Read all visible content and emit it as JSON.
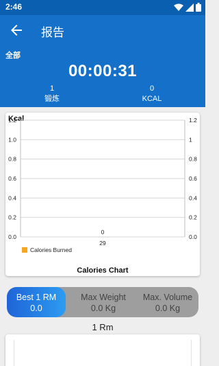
{
  "status_bar": {
    "time": "2:46",
    "icons": [
      "wifi-icon",
      "signal-icon",
      "battery-icon"
    ]
  },
  "app_bar": {
    "title": "报告",
    "back_icon": "arrow-left-icon"
  },
  "summary": {
    "label": "全部",
    "timer": "00:00:31",
    "stats": [
      {
        "value": "1",
        "label": "锻炼"
      },
      {
        "value": "0",
        "label": "KCAL"
      }
    ]
  },
  "chart_data": {
    "type": "bar",
    "ylabel": "Kcal",
    "categories": [
      "29"
    ],
    "series": [
      {
        "name": "Calories Burned",
        "values": [
          0
        ],
        "color": "#f5a623"
      }
    ],
    "data_labels": [
      "0"
    ],
    "ylim_left": [
      0,
      1.2
    ],
    "yticks_left": [
      "0.0",
      "0.2",
      "0.4",
      "0.6",
      "0.8",
      "1.0",
      "1.2"
    ],
    "ylim_right": [
      0,
      1.2
    ],
    "yticks_right": [
      "0.0",
      "0.2",
      "0.4",
      "0.6",
      "0.8",
      "1",
      "1.2"
    ],
    "grid": true,
    "legend_position": "bottom-left",
    "caption": "Calories Chart"
  },
  "segments": [
    {
      "title": "Best 1 RM",
      "value": "0.0",
      "selected": true
    },
    {
      "title": "Max Weight",
      "value": "0.0 Kg",
      "selected": false
    },
    {
      "title": "Max. Volume",
      "value": "0.0 Kg",
      "selected": false
    }
  ],
  "rm_label": "1 Rm",
  "colors": {
    "primary": "#1470c8",
    "status_bar": "#0a5fb0",
    "accent": "#2d9cf0",
    "legend": "#f5a623"
  }
}
